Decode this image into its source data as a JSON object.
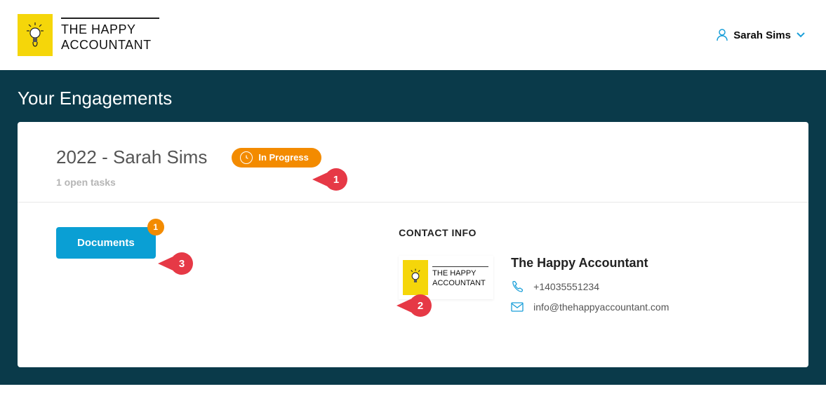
{
  "brand": {
    "name_line1": "THE HAPPY",
    "name_line2": "ACCOUNTANT",
    "small_line1": "THE HAPPY",
    "small_line2": "ACCOUNTANT"
  },
  "user": {
    "name": "Sarah Sims"
  },
  "page": {
    "title": "Your Engagements"
  },
  "engagement": {
    "title": "2022 - Sarah Sims",
    "status_label": "In Progress",
    "open_tasks_text": "1 open tasks"
  },
  "documents": {
    "button_label": "Documents",
    "badge_count": "1"
  },
  "contact": {
    "heading": "CONTACT INFO",
    "name": "The Happy Accountant",
    "phone": "+14035551234",
    "email": "info@thehappyaccountant.com"
  },
  "callouts": {
    "c1": "1",
    "c2": "2",
    "c3": "3"
  }
}
